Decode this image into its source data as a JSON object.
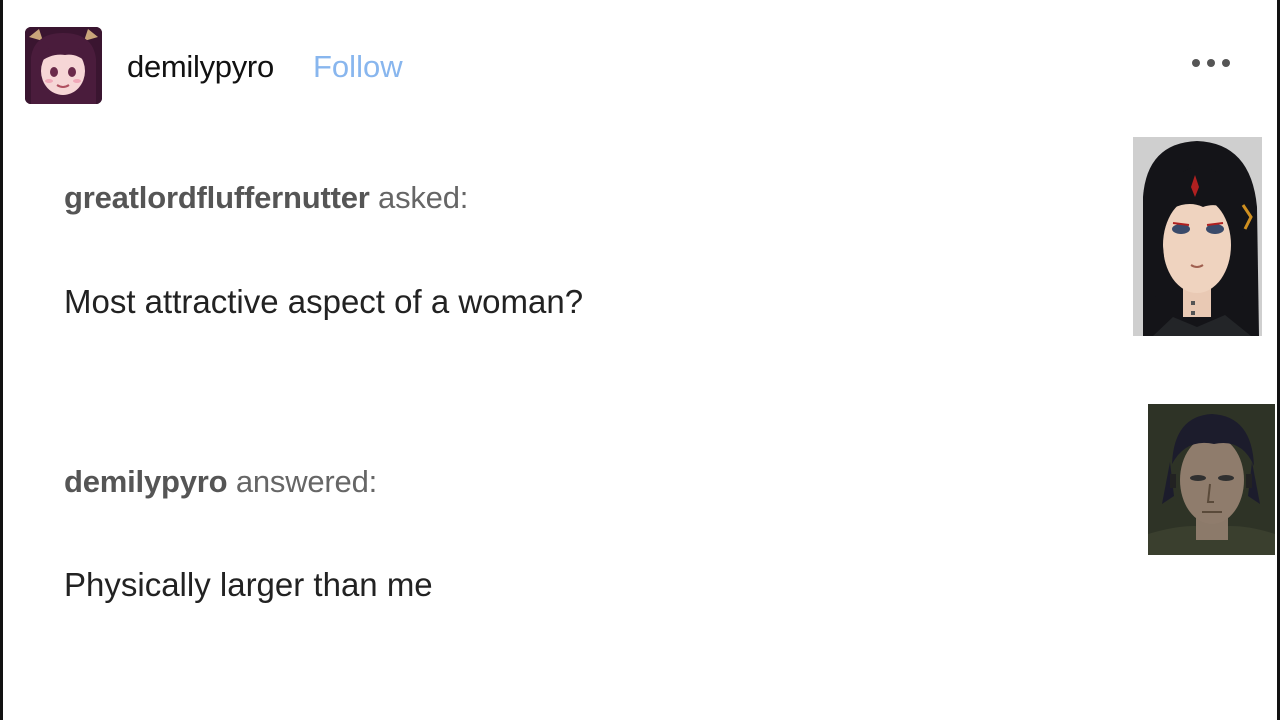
{
  "post": {
    "author": "demilypyro",
    "follow_label": "Follow",
    "more_icon": "ellipsis-icon"
  },
  "ask": {
    "asker": "greatlordfluffernutter",
    "asked_label": "asked:",
    "question": "Most attractive aspect of a woman?"
  },
  "answer": {
    "answerer": "demilypyro",
    "answered_label": "answered:",
    "text": "Physically larger than me"
  },
  "colors": {
    "follow": "#88b6ee",
    "text": "#222222",
    "meta": "#666666"
  }
}
